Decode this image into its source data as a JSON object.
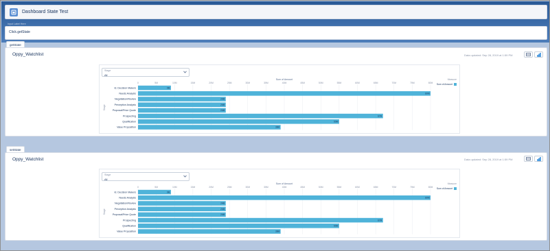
{
  "header": {
    "title": "Dashboard State Test"
  },
  "textbox": {
    "label": "Input Label Here",
    "value": "Click.getState"
  },
  "panels": [
    {
      "tab_label": "getState",
      "title": "Oppy_Watchlist",
      "updated": "Data updated: Sep 28, 2019 at 1:59 PM",
      "filter": {
        "label": "Stage",
        "value": "All"
      }
    },
    {
      "tab_label": "setState",
      "title": "Oppy_Watchlist",
      "updated": "Data updated: Sep 28, 2019 at 1:59 PM",
      "filter": {
        "label": "Stage",
        "value": "All"
      }
    }
  ],
  "icons": {
    "table": "table-icon",
    "chart": "bar-chart-icon",
    "app": "dashboard-app-icon",
    "dropdown": "chevron-down-icon"
  },
  "colors": {
    "bar": "#4fb3d9",
    "header_band": "#2a5a96",
    "background": "#b5c7e0"
  },
  "chart_data": [
    {
      "type": "bar",
      "orientation": "horizontal",
      "title": "Sum of Amount",
      "ylabel": "Stage",
      "legend_title": "Measure",
      "legend": [
        "Sum of Amount"
      ],
      "legend_position": "top-right",
      "x_ticks": [
        "0",
        "5M",
        "10M",
        "15M",
        "20M",
        "25M",
        "30M",
        "35M",
        "40M",
        "45M",
        "50M",
        "55M",
        "60M",
        "65M",
        "70M",
        "75M",
        "80M"
      ],
      "xlim": [
        0,
        80
      ],
      "categories": [
        "Id. Decision Makers",
        "Needs Analysis",
        "Negotiation/Review",
        "Perception Analysis",
        "Proposal/Price Quote",
        "Prospecting",
        "Qualification",
        "Value Proposition"
      ],
      "values": [
        9,
        80,
        24,
        24,
        24,
        67,
        55,
        39
      ],
      "labels": [
        "9M",
        "80M",
        "24M",
        "24M",
        "24M",
        "67M",
        "55M",
        "39M"
      ]
    },
    {
      "type": "bar",
      "orientation": "horizontal",
      "title": "Sum of Amount",
      "ylabel": "Stage",
      "legend_title": "Measure",
      "legend": [
        "Sum of Amount"
      ],
      "legend_position": "top-right",
      "x_ticks": [
        "0",
        "5M",
        "10M",
        "15M",
        "20M",
        "25M",
        "30M",
        "35M",
        "40M",
        "45M",
        "50M",
        "55M",
        "60M",
        "65M",
        "70M",
        "75M",
        "80M"
      ],
      "xlim": [
        0,
        80
      ],
      "categories": [
        "Id. Decision Makers",
        "Needs Analysis",
        "Negotiation/Review",
        "Perception Analysis",
        "Proposal/Price Quote",
        "Prospecting",
        "Qualification",
        "Value Proposition"
      ],
      "values": [
        9,
        80,
        24,
        24,
        24,
        67,
        55,
        39
      ],
      "labels": [
        "9M",
        "80M",
        "24M",
        "24M",
        "24M",
        "67M",
        "55M",
        "39M"
      ]
    }
  ]
}
